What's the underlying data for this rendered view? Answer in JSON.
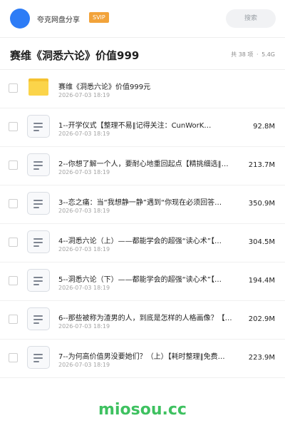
{
  "header": {
    "share_name": "夸克网盘分享",
    "vip_label": "SVIP",
    "search_placeholder": "搜索"
  },
  "folder": {
    "title": "赛维《洞悉六论》价值999",
    "count": "共 38 项",
    "separator": "·",
    "size": "5.4G"
  },
  "items": [
    {
      "type": "folder",
      "name": "赛维《洞悉六论》价值999元",
      "date": "2026-07-03 18:19",
      "size": ""
    },
    {
      "type": "file",
      "name": "1--开学仪式【整理不易‖记得关注：CunWorK…",
      "date": "2026-07-03 18:19",
      "size": "92.8M"
    },
    {
      "type": "file",
      "name": "2--你想了解一个人，要耐心地重回起点【精挑细选‖…",
      "date": "2026-07-03 18:19",
      "size": "213.7M"
    },
    {
      "type": "file",
      "name": "3--恋之痛：当“我想静一静”遇到“你现在必须回答…",
      "date": "2026-07-03 18:19",
      "size": "350.9M"
    },
    {
      "type": "file",
      "name": "4--洞悉六论（上）——都能学会的超强“读心术”【…",
      "date": "2026-07-03 18:19",
      "size": "304.5M"
    },
    {
      "type": "file",
      "name": "5--洞悉六论（下）——都能学会的超强“读心术”【…",
      "date": "2026-07-03 18:19",
      "size": "194.4M"
    },
    {
      "type": "file",
      "name": "6--那些被称为渣男的人，到底是怎样的人格画像？【…",
      "date": "2026-07-03 18:19",
      "size": "202.9M"
    },
    {
      "type": "file",
      "name": "7--为何高价值男没要她们？（上）【耗时整理‖免费…",
      "date": "2026-07-03 18:19",
      "size": "223.9M"
    }
  ],
  "watermark": "miosou.cc"
}
